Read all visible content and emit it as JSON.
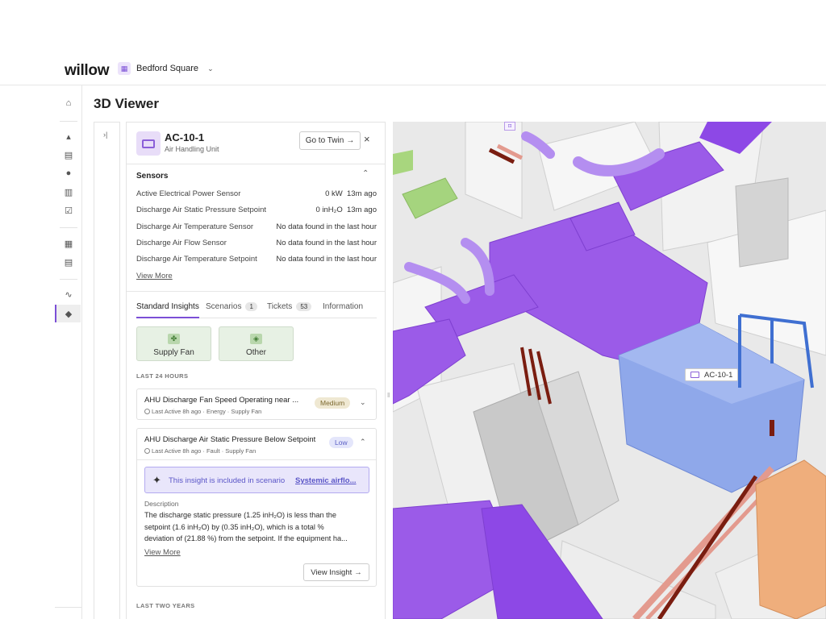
{
  "app": {
    "logo": "willow",
    "site": "Bedford Square"
  },
  "page": {
    "title": "3D Viewer"
  },
  "twin": {
    "name": "AC-10-1",
    "type": "Air Handling Unit",
    "goto_label": "Go to Twin",
    "close_label": "×"
  },
  "sensors": {
    "title": "Sensors",
    "items": [
      {
        "name": "Active Electrical Power Sensor",
        "value": "0 kW  13m ago"
      },
      {
        "name": "Discharge Air Static Pressure Setpoint",
        "value": "0 inH₂O  13m ago"
      },
      {
        "name": "Discharge Air Temperature Sensor",
        "value": "No data found in the last hour"
      },
      {
        "name": "Discharge Air Flow Sensor",
        "value": "No data found in the last hour"
      },
      {
        "name": "Discharge Air Temperature Setpoint",
        "value": "No data found in the last hour"
      }
    ],
    "view_more": "View More"
  },
  "tabs": [
    {
      "label": "Standard Insights",
      "count": ""
    },
    {
      "label": "Scenarios",
      "count": "1"
    },
    {
      "label": "Tickets",
      "count": "53"
    },
    {
      "label": "Information",
      "count": ""
    }
  ],
  "categories": [
    {
      "label": "Supply Fan",
      "icon": "fan-icon"
    },
    {
      "label": "Other",
      "icon": "other-icon"
    }
  ],
  "groups": {
    "last24": "LAST 24 HOURS",
    "last2y": "LAST TWO YEARS"
  },
  "insights": [
    {
      "title": "AHU Discharge Fan Speed Operating near ...",
      "meta": "Last Active 8h ago · Energy · Supply Fan",
      "priority": "Medium"
    },
    {
      "title": "AHU Discharge Air Static Pressure Below Setpoint",
      "meta": "Last Active 8h ago · Fault · Supply Fan",
      "priority": "Low",
      "scenario_text": "This insight is included in scenario",
      "scenario_link": "Systemic airflo...",
      "description_label": "Description",
      "description_lines": [
        "The discharge static pressure (1.25 inH₂O) is less than the",
        "setpoint (1.6 inH₂O) by (0.35 inH₂O), which is a total %",
        "deviation of (21.88 %) from the setpoint. If the equipment ha..."
      ],
      "view_more": "View More",
      "view_insight": "View Insight"
    }
  ],
  "viewer": {
    "selected_label": "AC-10-1",
    "colors": {
      "duct": "#9b5be8",
      "ahu": "#8fa8ea",
      "pipe_hot": "#e39a8e",
      "pipe_dark": "#7a1d10",
      "wall": "#e4e4e4",
      "accent": "#7b4fd6"
    }
  }
}
